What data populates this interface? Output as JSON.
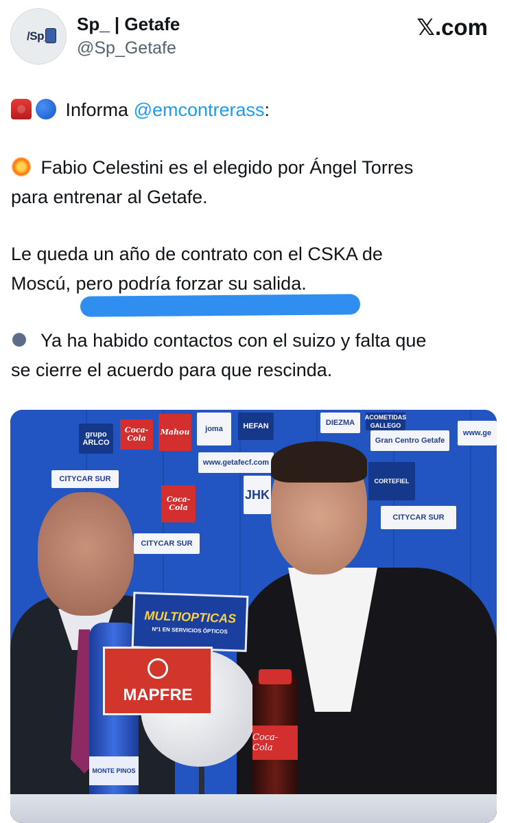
{
  "header": {
    "avatar_text": "/Sp_",
    "display_name": "Sp_ | Getafe",
    "handle": "@Sp_Getafe",
    "brand": "𝕏.com"
  },
  "tweet": {
    "line1_prefix": "Informa ",
    "line1_mention": "@emcontrerass",
    "line1_suffix": ":",
    "line2": "Fabio Celestini es el elegido por Ángel Torres",
    "line3": "para entrenar al Getafe.",
    "line4": "Le queda un año de contrato con el CSKA de",
    "line5": "Moscú, pero podría forzar su salida.",
    "line6": "Ya ha habido contactos con el suizo y falta que",
    "line7": "se cierre el acuerdo para que rescinda."
  },
  "photo": {
    "sponsors": [
      "Coca-Cola",
      "Mahou",
      "joma",
      "HEFAN",
      "DIEZMA",
      "ACOMETIDAS GALLEGO",
      "Gran Centro Getafe",
      "www.ge",
      "grupo ARLCO",
      "CITYCAR SUR",
      "www.getafecf.com",
      "JHK",
      "CORTEFIEL"
    ],
    "multiopticas": "MULTIOPTICAS",
    "multiopticas_sub": "Nº1 EN SERVICIOS ÓPTICOS",
    "mapfre": "MAPFRE",
    "water_label": "MONTE PINOS",
    "coke_label": "Coca-Cola"
  }
}
